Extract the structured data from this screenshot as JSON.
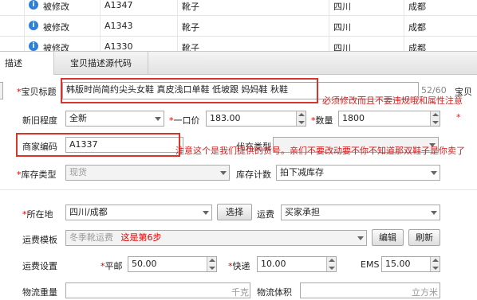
{
  "table": {
    "rows": [
      {
        "status": "被修改",
        "code": "A1347",
        "name": "靴子",
        "province": "四川",
        "city": "成都"
      },
      {
        "status": "被修改",
        "code": "A1343",
        "name": "靴子",
        "province": "四川",
        "city": "成都"
      },
      {
        "status": "被修改",
        "code": "A1330",
        "name": "靴子",
        "province": "四川",
        "city": "成都"
      }
    ]
  },
  "tabs": [
    "描述",
    "宝贝描述源代码"
  ],
  "form": {
    "title_label": "宝贝标题",
    "title_value": "韩版时尚简约尖头女鞋 真皮浅口单鞋 低坡跟 妈妈鞋 秋鞋",
    "title_counter": "52/60",
    "title_note": "必须修改而且不要违规哦和属性注意",
    "right_label": "宝贝",
    "condition_label": "新旧程度",
    "condition_value": "全新",
    "price_label": "一口价",
    "price_value": "183.00",
    "qty_label": "数量",
    "qty_value": "1800",
    "merchant_code_label": "商家编码",
    "merchant_code_value": "A1337",
    "category_label": "代充类型",
    "code_note": "注意这个是我们提供的货号。亲们不要改动要不你不知道那双鞋子是你卖了",
    "stock_type_label": "库存类型",
    "stock_type_value": "现货",
    "stock_count_label": "库存计数",
    "stock_count_value": "拍下减库存",
    "location_label": "所在地",
    "location_value": "四川/成都",
    "select_button": "选择",
    "freight_label": "运费",
    "freight_value": "买家承担",
    "freight_tpl_label": "运费模板",
    "freight_tpl_value": "冬季靴运费",
    "freight_tpl_note": "这是第6步",
    "edit_button": "编辑",
    "refresh_button": "刷新",
    "freight_setting_label": "运费设置",
    "post_label": "平邮",
    "post_value": "50.00",
    "express_label": "快递",
    "express_value": "10.00",
    "ems_label": "EMS",
    "ems_value": "15.00",
    "weight_label": "物流重量",
    "weight_unit": "千克",
    "volume_label": "物流体积",
    "volume_unit": "立方米"
  },
  "colors": {
    "accent_red": "#d9342b",
    "info_icon": "#2f7fd6"
  }
}
